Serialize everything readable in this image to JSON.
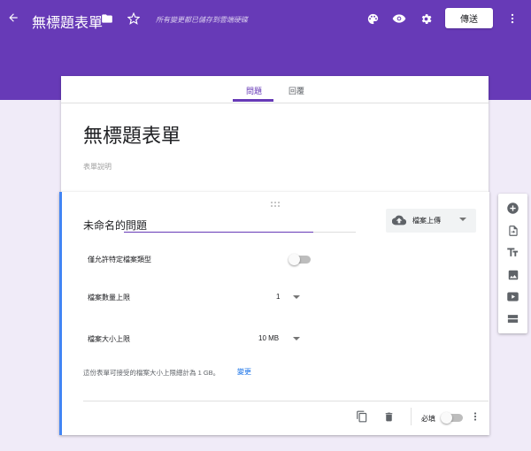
{
  "header": {
    "title": "無標題表單",
    "autosave_status": "所有變更都已儲存到雲端硬碟",
    "send_label": "傳送",
    "icons": [
      "back-arrow-icon",
      "folder-icon",
      "star-icon",
      "palette-icon",
      "eye-icon",
      "gear-icon",
      "more-vert-icon"
    ]
  },
  "tabs": [
    {
      "label": "問題",
      "active": true
    },
    {
      "label": "回覆",
      "active": false
    }
  ],
  "form": {
    "title": "無標題表單",
    "description_placeholder": "表單說明"
  },
  "question": {
    "title": "未命名的問題",
    "type_label": "檔案上傳",
    "allow_specific_types_label": "僅允許特定檔案類型",
    "allow_specific_types_on": false,
    "max_files_label": "檔案數量上限",
    "max_files_value": "1",
    "max_size_label": "檔案大小上限",
    "max_size_value": "10 MB",
    "note": "這份表單可接受的檔案大小上限總計為 1 GB。",
    "note_link": "變更",
    "required_label": "必填",
    "required_on": false
  },
  "side_panel": {
    "tools": [
      "add-question-icon",
      "import-question-icon",
      "title-text-icon",
      "image-icon",
      "video-icon",
      "section-icon"
    ]
  },
  "colors": {
    "brand": "#673ab7",
    "accent_blue": "#4285f4",
    "background": "#f0ebf8"
  }
}
